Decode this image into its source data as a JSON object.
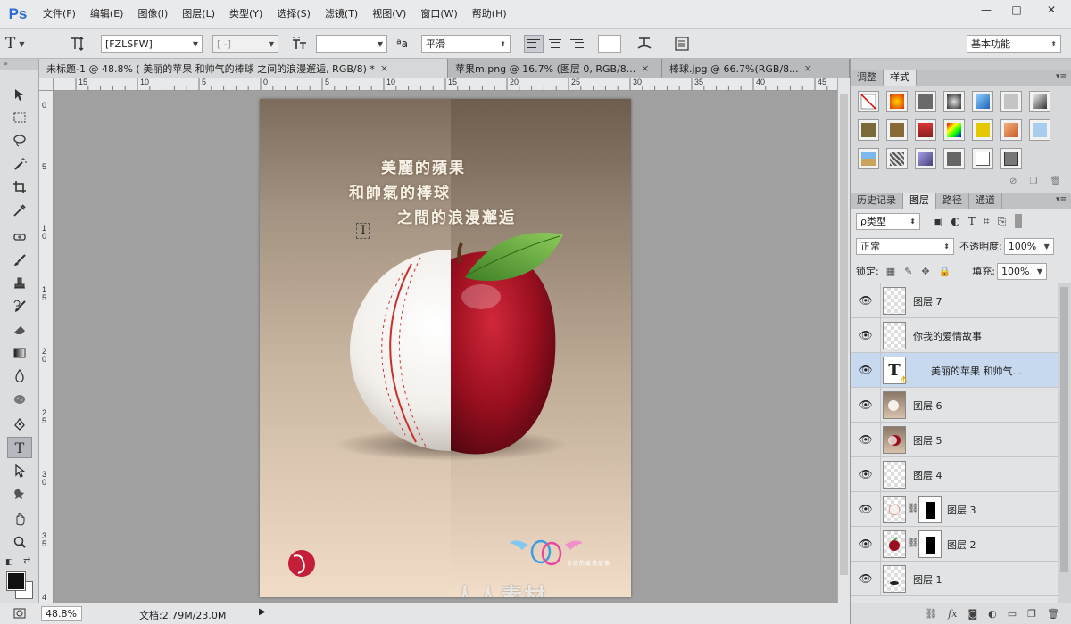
{
  "app": {
    "logo": "Ps",
    "menu": [
      "文件(F)",
      "编辑(E)",
      "图像(I)",
      "图层(L)",
      "类型(Y)",
      "选择(S)",
      "滤镜(T)",
      "视图(V)",
      "窗口(W)",
      "帮助(H)"
    ],
    "window_controls": {
      "minimize": "—",
      "maximize": "□",
      "close": "✕"
    }
  },
  "options": {
    "tool_glyph": "T",
    "font_family": "[FZLSFW]",
    "font_style": "[ -]",
    "font_size": "",
    "aa_label": "ªa",
    "antialias": "平滑",
    "workspace": "基本功能"
  },
  "tabs": [
    {
      "label": "未标题-1 @ 48.8% (    美丽的苹果 和帅气的棒球         之间的浪漫邂逅, RGB/8) *",
      "close": "×"
    },
    {
      "label": "苹果m.png @ 16.7% (图层 0, RGB/8...",
      "close": "×"
    },
    {
      "label": "棒球.jpg @ 66.7%(RGB/8...",
      "close": "×"
    }
  ],
  "rulers": {
    "top_labels": [
      "15",
      "10",
      "5",
      "0",
      "5",
      "10",
      "15",
      "20",
      "25",
      "30",
      "35",
      "40",
      "45"
    ],
    "left_labels": [
      "0",
      "5",
      "10",
      "15",
      "20",
      "25",
      "30",
      "35",
      "4"
    ]
  },
  "artwork": {
    "line1": "美麗的蘋果",
    "line2": "和帥氣的棒球",
    "line3": "之間的浪漫邂逅",
    "signature": "你我的爱情故事",
    "watermark": "人人素材"
  },
  "status": {
    "zoom": "48.8%",
    "doc_info": "文档:2.79M/23.0M",
    "arrow": "▶"
  },
  "panels": {
    "top_tabs": [
      "调整",
      "样式"
    ],
    "layers_tabs": [
      "历史记录",
      "图层",
      "路径",
      "通道"
    ],
    "filter_kind": "ρ类型",
    "blend_mode": "正常",
    "opacity_label": "不透明度:",
    "opacity_value": "100%",
    "lock_label": "锁定:",
    "fill_label": "填充:",
    "fill_value": "100%"
  },
  "layers": [
    {
      "name": "图层 7",
      "thumb": "empty"
    },
    {
      "name": "你我的爱情故事",
      "thumb": "empty"
    },
    {
      "name": "美丽的苹果 和帅气...",
      "thumb": "type",
      "selected": true
    },
    {
      "name": "图层 6",
      "thumb": "baseball-photo"
    },
    {
      "name": "图层 5",
      "thumb": "apple-photo"
    },
    {
      "name": "图层 4",
      "thumb": "empty"
    },
    {
      "name": "图层 3",
      "thumb": "baseball-small",
      "mask": true
    },
    {
      "name": "图层 2",
      "thumb": "apple-small",
      "mask": true
    },
    {
      "name": "图层 1",
      "thumb": "shadow"
    }
  ],
  "layers_footer": [
    "⛓",
    "fx",
    "◙",
    "◐",
    "▭",
    "❐",
    "🗑"
  ],
  "colors": {
    "accent": "#2c6bd6",
    "selected_layer": "#c7d9ef",
    "apple_red": "#a01020",
    "leaf_green": "#4f9a34",
    "ball_stitch": "#c8302a"
  }
}
